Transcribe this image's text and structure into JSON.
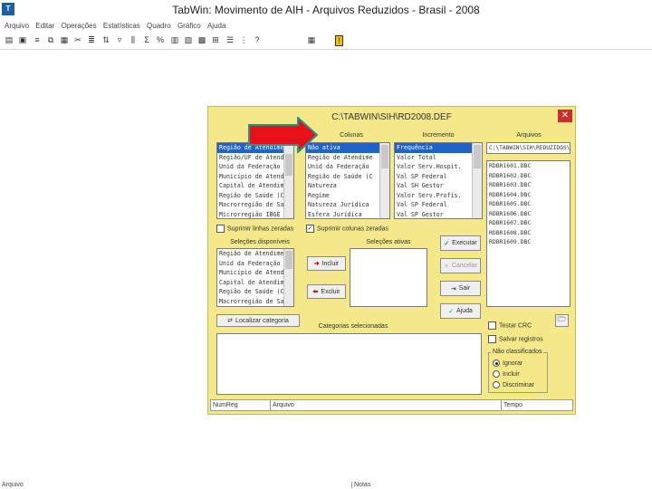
{
  "window": {
    "title": "TabWin: Movimento de AIH - Arquivos Reduzidos - Brasil - 2008",
    "app_icon": "tabwin-icon"
  },
  "menu": [
    "Arquivo",
    "Editar",
    "Operações",
    "Estatísticas",
    "Quadro",
    "Gráfico",
    "Ajuda"
  ],
  "toolbar_icons": [
    "open-icon",
    "save-icon",
    "print-icon",
    "copy-icon",
    "paste-icon",
    "cut-icon",
    "format-icon",
    "sort-icon",
    "filter-icon",
    "columns-icon",
    "sum-icon",
    "percent-icon",
    "stats-icon",
    "chart-icon",
    "map-icon",
    "calc-icon",
    "help-icon"
  ],
  "dialog": {
    "title": "C:\\TABWIN\\SIH\\RD2008.DEF",
    "columns_label": "Colunas",
    "columns_items": [
      "Não ativa",
      "Região de Atendime",
      "Unid da Federação",
      "Região de Saúde (C",
      "Natureza",
      "Regime",
      "Natureza Jurídica",
      "Esfera Jurídica"
    ],
    "columns_selected": 0,
    "increment_label": "Incremento",
    "increment_items": [
      "Frequência",
      "Valor Total",
      "Valor Serv.Hospit.",
      "Val SP Federal",
      "Val SH Gestor",
      "Valor Serv.Profis.",
      "Val SP Federal",
      "Val SP Gestor"
    ],
    "increment_selected": 0,
    "rows_items": [
      "Região de Atendime",
      "Região/UF de Atend",
      "Unid da Federação",
      "Município de Atend",
      "Capital de Atendim",
      "Região de Saúde (C",
      "Macrorregião de Sa",
      "Microrregião IBGE"
    ],
    "rows_selected": 0,
    "files_label": "Arquivos",
    "files_path": "C:\\TABWIN\\SIH\\REDUZIDOS\\*F",
    "files_items": [
      "RDBR1601.DBC",
      "RDBR1602.DBC",
      "RDBR1603.DBC",
      "RDBR1604.DBC",
      "RDBR1605.DBC",
      "RDBR1606.DBC",
      "RDBR1607.DBC",
      "RDBR1608.DBC",
      "RDBR1609.DBC"
    ],
    "suppress_rows": "Suprimir linhas zeradas",
    "suppress_cols": "Suprimir colunas zeradas",
    "available_label": "Seleções disponíveis",
    "available_items": [
      "Região de Atendime",
      "Unid da Federação",
      "Município de Atend",
      "Capital de Atendim",
      "Região de Saúde (C",
      "Macrorregião de Sa"
    ],
    "active_label": "Seleções ativas",
    "include_btn": "Incluir",
    "exclude_btn": "Excluir",
    "execute_btn": "Executar",
    "cancel_btn": "Cancelar",
    "exit_btn": "Sair",
    "help_btn": "Ajuda",
    "locate_btn": "Localizar categoria",
    "categories_label": "Categorias selecionadas",
    "test_crc": "Testar CRC",
    "save_records": "Salvar registros",
    "unclassified_label": "Não classificados",
    "radio_options": [
      "Ignorar",
      "Incluir",
      "Discriminar"
    ],
    "radio_selected": 0,
    "table_headers": [
      "NumReg",
      "Arquivo",
      "Tempo"
    ]
  },
  "status": {
    "left": "Arquivo",
    "right": "Notas"
  },
  "colors": {
    "dialog_bg": "#f5e889",
    "selection": "#1f62c8",
    "annotation_arrow": "#e8101a",
    "arrow_outline": "#1a9a8a"
  }
}
